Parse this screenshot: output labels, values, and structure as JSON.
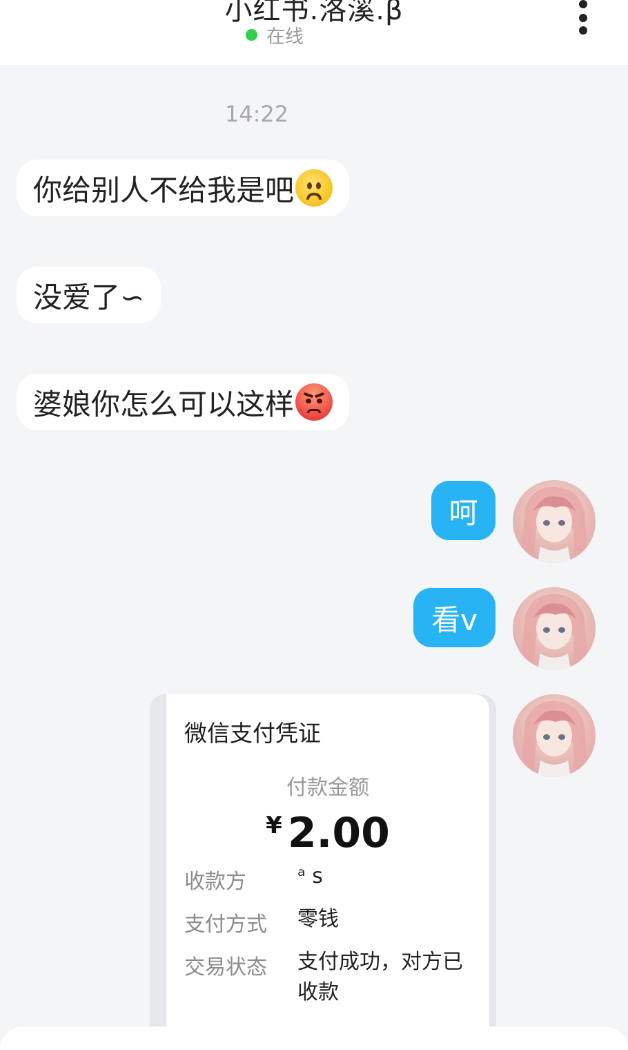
{
  "header": {
    "title": "小红书.洛溪.β",
    "status": "在线",
    "more_icon": "more-vertical-icon"
  },
  "chat": {
    "timestamp": "14:22",
    "incoming": [
      {
        "text": "你给别人不给我是吧",
        "emoji": "confused-face-icon"
      },
      {
        "text": "没爱了∽"
      },
      {
        "text": "婆娘你怎么可以这样",
        "emoji": "angry-face-icon"
      }
    ],
    "outgoing": [
      {
        "text": "呵"
      },
      {
        "text": "看v"
      }
    ],
    "payment_card": {
      "title": "微信支付凭证",
      "amount_label": "付款金额",
      "currency": "¥",
      "amount": "2.00",
      "rows": [
        {
          "label": "收款方",
          "value": "ᵃ s"
        },
        {
          "label": "支付方式",
          "value": "零钱"
        },
        {
          "label": "交易状态",
          "value": "支付成功，对方已收款"
        }
      ]
    }
  },
  "colors": {
    "outgoing_bubble": "#27b3f4",
    "online_dot": "#2fd04e",
    "background": "#f4f5f7"
  }
}
